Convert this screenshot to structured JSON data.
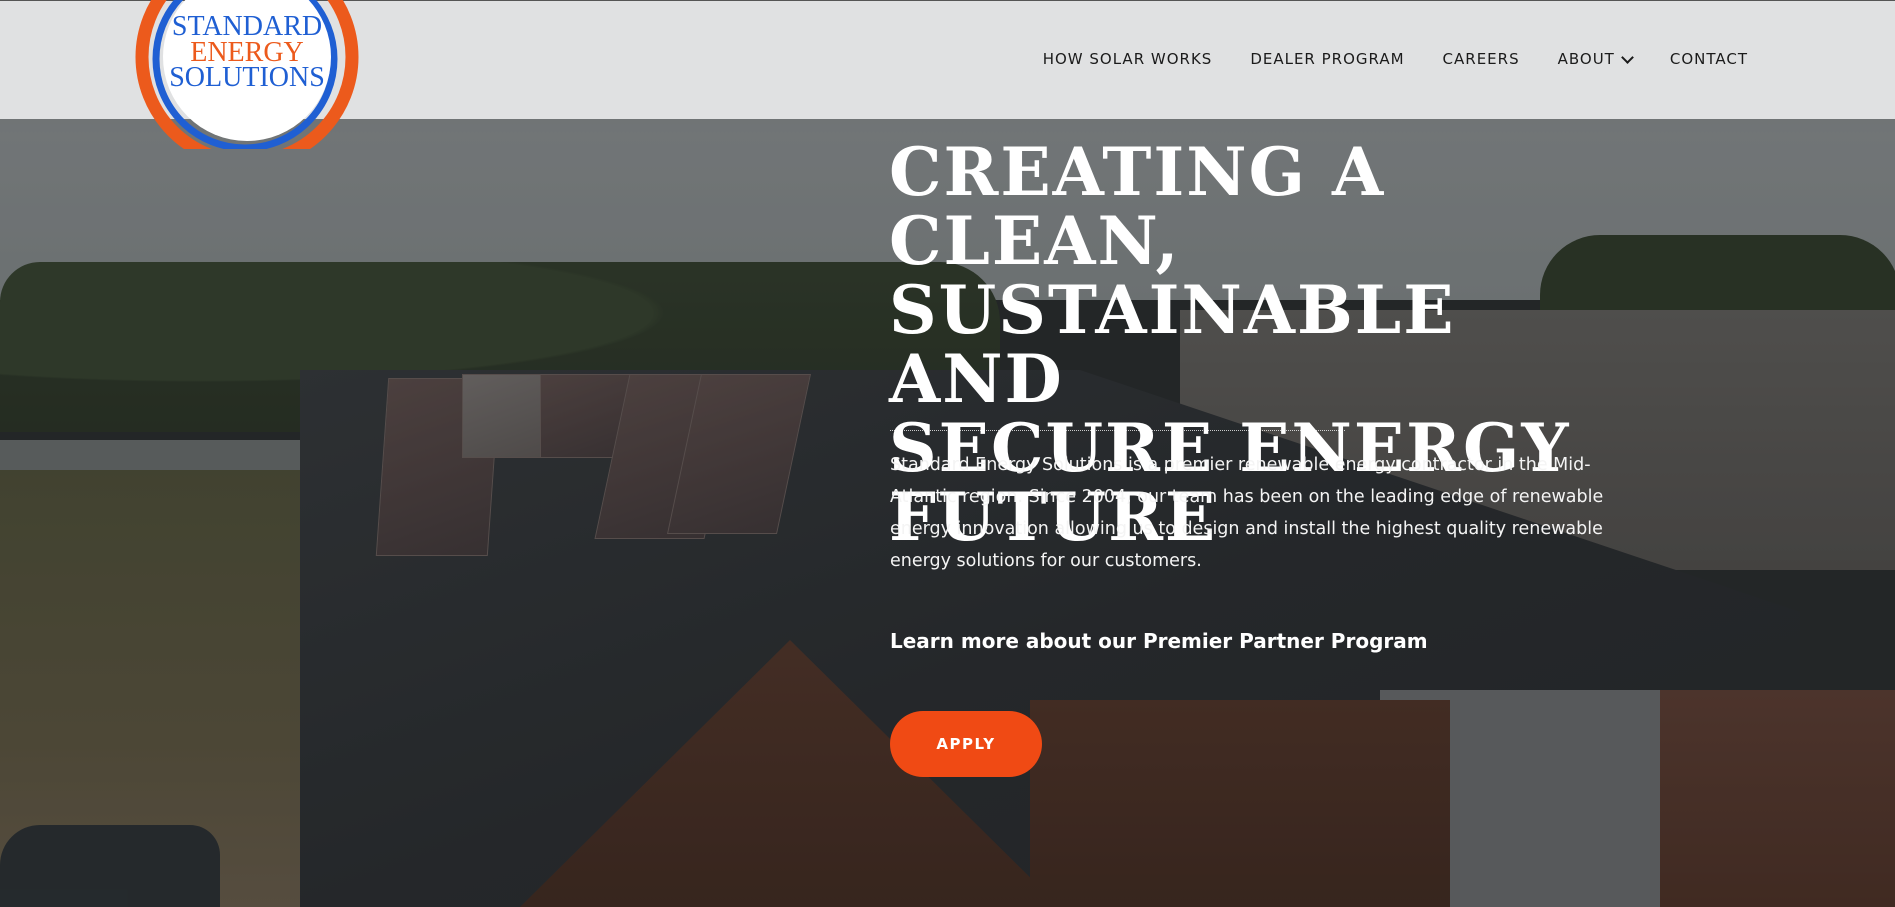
{
  "header": {
    "logo": {
      "line1": "STANDARD",
      "line2": "ENERGY",
      "line3": "SOLUTIONS",
      "colors": {
        "orange": "#ec5a1c",
        "blue": "#1f5fd3"
      }
    },
    "nav": [
      {
        "label": "HOW SOLAR WORKS"
      },
      {
        "label": "DEALER PROGRAM"
      },
      {
        "label": "CAREERS"
      },
      {
        "label": "ABOUT",
        "has_dropdown": true
      },
      {
        "label": "CONTACT"
      }
    ]
  },
  "hero": {
    "headline_lines": [
      "CREATING A CLEAN,",
      "SUSTAINABLE AND",
      "SECURE ENERGY",
      "FUTURE"
    ],
    "intro": "Standard Energy Solutions is a premier renewable energy contractor in the Mid-Atlantic region.  Since 2004, our team has been on the leading edge of renewable energy innovation allowing us to design and install the highest quality renewable energy solutions for our customers.",
    "partner_link": "Learn more about our Premier Partner Program",
    "apply_label": "APPLY"
  },
  "colors": {
    "accent": "#f04a14",
    "header_bg": "#e0e1e2",
    "text_light": "#ffffff"
  }
}
